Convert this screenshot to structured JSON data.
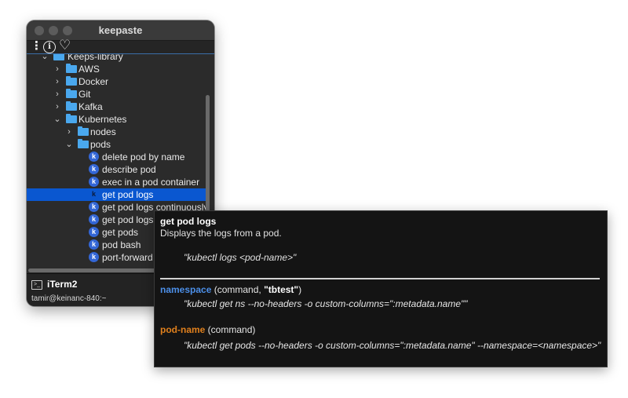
{
  "window": {
    "title": "keepaste",
    "toolbar": {
      "menu_icon": "kebab-menu-icon",
      "info_icon": "info-icon",
      "favorites_icon": "heart-icon",
      "menu_glyph": "⋮",
      "info_glyph": "i",
      "heart_glyph": "♡"
    }
  },
  "tree": {
    "rows": [
      {
        "label": "Keeps-library",
        "chevron": "⌄",
        "type": "folder"
      },
      {
        "label": "AWS",
        "chevron": "›",
        "type": "folder"
      },
      {
        "label": "Docker",
        "chevron": "›",
        "type": "folder"
      },
      {
        "label": "Git",
        "chevron": "›",
        "type": "folder"
      },
      {
        "label": "Kafka",
        "chevron": "›",
        "type": "folder"
      },
      {
        "label": "Kubernetes",
        "chevron": "⌄",
        "type": "folder"
      },
      {
        "label": "nodes",
        "chevron": "›",
        "type": "folder"
      },
      {
        "label": "pods",
        "chevron": "⌄",
        "type": "folder"
      },
      {
        "label": "delete pod by name",
        "type": "keep",
        "icon_letter": "k"
      },
      {
        "label": "describe pod",
        "type": "keep",
        "icon_letter": "k"
      },
      {
        "label": "exec in a pod container",
        "type": "keep",
        "icon_letter": "k"
      },
      {
        "label": "get pod logs",
        "type": "keep",
        "icon_letter": "k",
        "selected": true
      },
      {
        "label": "get pod logs continuously",
        "type": "keep",
        "icon_letter": "k"
      },
      {
        "label": "get pod logs",
        "type": "keep",
        "icon_letter": "k"
      },
      {
        "label": "get pods",
        "type": "keep",
        "icon_letter": "k"
      },
      {
        "label": "pod bash",
        "type": "keep",
        "icon_letter": "k"
      },
      {
        "label": "port-forward",
        "type": "keep",
        "icon_letter": "k"
      }
    ]
  },
  "status": {
    "app_name": "iTerm2",
    "app_sub": "tamir@keinanc-840:~",
    "term_glyph": ">_"
  },
  "popup": {
    "title": "get pod logs",
    "description": "Displays the logs from a pod.",
    "command": "\"kubectl logs <pod-name>\"",
    "args": [
      {
        "name": "namespace",
        "kind_prefix": " (command, ",
        "default": "\"tbtest\"",
        "kind_suffix": ")",
        "command": "\"kubectl get ns --no-headers -o custom-columns=\":metadata.name\"\""
      },
      {
        "name": "pod-name",
        "kind": " (command)",
        "command": "\"kubectl get pods --no-headers -o custom-columns=\":metadata.name\" --namespace=<namespace>\""
      }
    ]
  },
  "colors": {
    "selection": "#0a57d0",
    "folder": "#4aa8ee",
    "keep_icon": "#3366d6",
    "arg_blue": "#4c8fe8",
    "arg_orange": "#e0801d"
  }
}
